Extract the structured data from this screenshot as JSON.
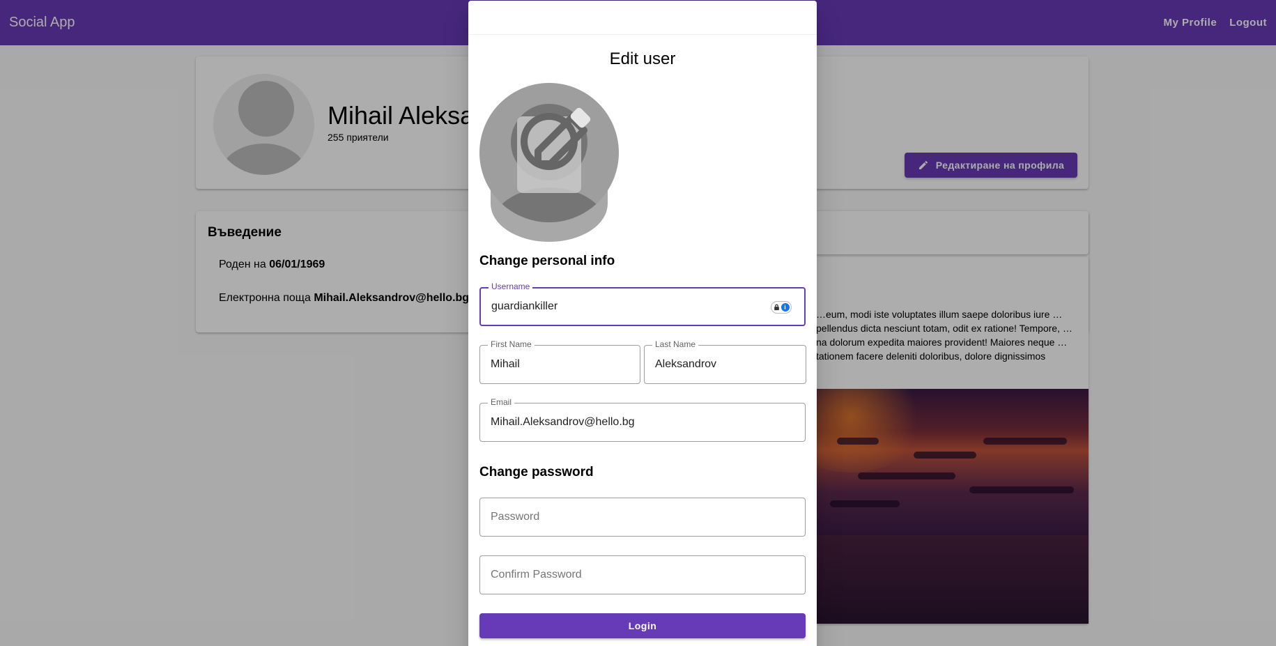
{
  "app": {
    "title": "Social App"
  },
  "nav": {
    "my_profile": "My Profile",
    "logout": "Logout"
  },
  "profile": {
    "name": "Mihail Aleksandrov",
    "friends": "255 приятели",
    "edit_button": "Редактиране на профила"
  },
  "intro": {
    "title": "Въведение",
    "born_label": "Роден на",
    "born_value": "06/01/1969",
    "email_label": "Електронна поща",
    "email_value": "Mihail.Aleksandrov@hello.bg"
  },
  "post": {
    "text": "…eum, modi iste voluptates illum saepe doloribus iure …pellendus dicta nesciunt totam, odit ex ratione! Tempore, …na dolorum expedita maiores provident! Maiores neque …tationem facere deleniti doloribus, dolore dignissimos"
  },
  "dialog": {
    "title": "Edit user",
    "personal_section": "Change personal info",
    "username": {
      "label": "Username",
      "value": "guardiankiller"
    },
    "first_name": {
      "label": "First Name",
      "value": "Mihail"
    },
    "last_name": {
      "label": "Last Name",
      "value": "Aleksandrov"
    },
    "email": {
      "label": "Email",
      "value": "Mihail.Aleksandrov@hello.bg"
    },
    "password_section": "Change password",
    "password": {
      "placeholder": "Password"
    },
    "confirm_password": {
      "placeholder": "Confirm Password"
    },
    "submit": "Login"
  },
  "colors": {
    "primary": "#673ab7",
    "backdrop": "rgba(0,0,0,0.32)"
  },
  "icons": [
    "edit-icon",
    "lock-icon",
    "info-icon",
    "avatar-icon"
  ]
}
